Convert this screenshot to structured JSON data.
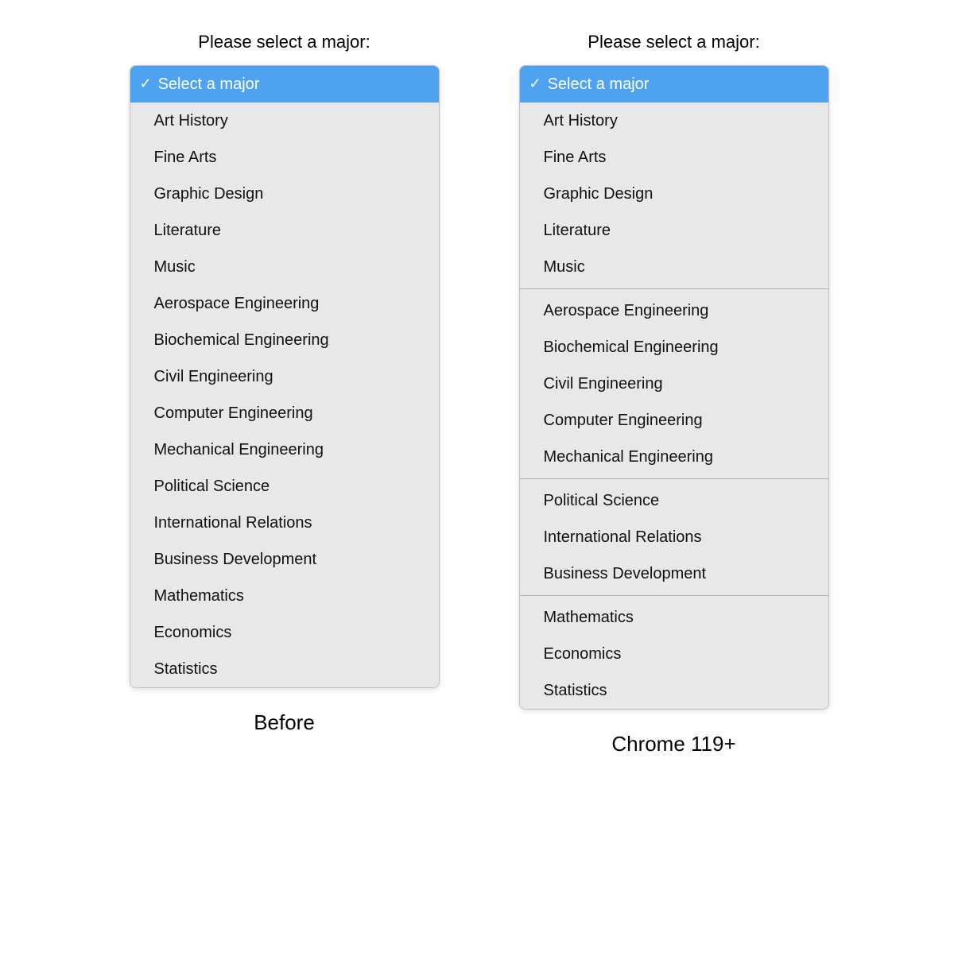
{
  "left": {
    "label": "Please select a major:",
    "caption": "Before",
    "selected": "Select a major",
    "items": [
      {
        "label": "Select a major",
        "selected": true
      },
      {
        "label": "Art History"
      },
      {
        "label": "Fine Arts"
      },
      {
        "label": "Graphic Design"
      },
      {
        "label": "Literature"
      },
      {
        "label": "Music"
      },
      {
        "label": "Aerospace Engineering"
      },
      {
        "label": "Biochemical Engineering"
      },
      {
        "label": "Civil Engineering"
      },
      {
        "label": "Computer Engineering"
      },
      {
        "label": "Mechanical Engineering"
      },
      {
        "label": "Political Science"
      },
      {
        "label": "International Relations"
      },
      {
        "label": "Business Development"
      },
      {
        "label": "Mathematics"
      },
      {
        "label": "Economics"
      },
      {
        "label": "Statistics"
      }
    ]
  },
  "right": {
    "label": "Please select a major:",
    "caption": "Chrome 119+",
    "selected": "Select a major",
    "groups": [
      {
        "items": [
          {
            "label": "Select a major",
            "selected": true
          }
        ]
      },
      {
        "items": [
          {
            "label": "Art History"
          },
          {
            "label": "Fine Arts"
          },
          {
            "label": "Graphic Design"
          },
          {
            "label": "Literature"
          },
          {
            "label": "Music"
          }
        ]
      },
      {
        "items": [
          {
            "label": "Aerospace Engineering"
          },
          {
            "label": "Biochemical Engineering"
          },
          {
            "label": "Civil Engineering"
          },
          {
            "label": "Computer Engineering"
          },
          {
            "label": "Mechanical Engineering"
          }
        ]
      },
      {
        "items": [
          {
            "label": "Political Science"
          },
          {
            "label": "International Relations"
          },
          {
            "label": "Business Development"
          }
        ]
      },
      {
        "items": [
          {
            "label": "Mathematics"
          },
          {
            "label": "Economics"
          },
          {
            "label": "Statistics"
          }
        ]
      }
    ]
  }
}
